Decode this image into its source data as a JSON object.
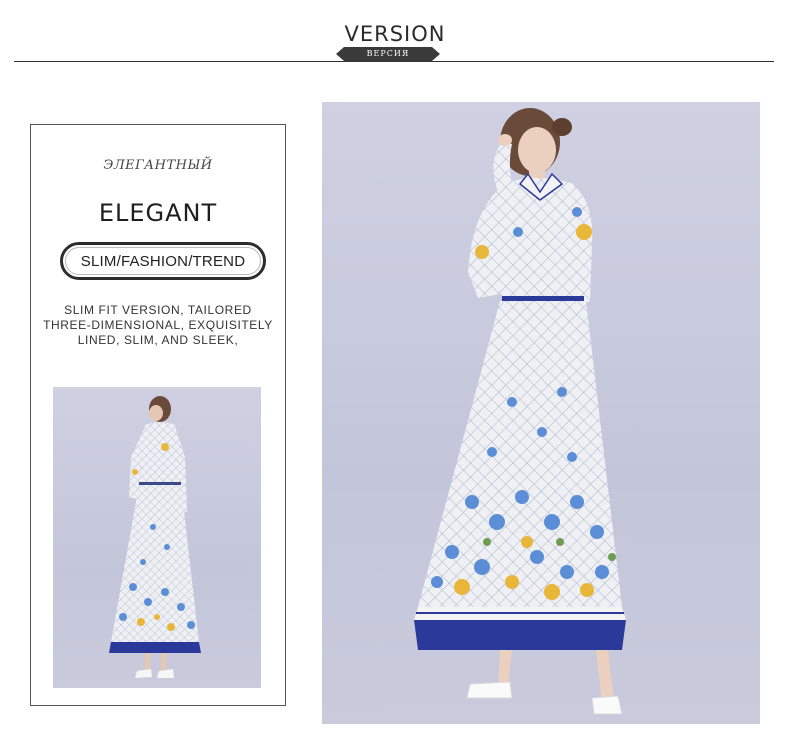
{
  "header": {
    "title": "VERSION",
    "subtitle": "ВЕРСИЯ"
  },
  "card": {
    "russian_title": "ЭЛЕГАНТНЫЙ",
    "english_title": "ELEGANT",
    "pill_text": "SLIM/FASHION/TREND",
    "description": "SLIM FIT VERSION, TAILORED THREE-DIMENSIONAL, EXQUISITELY LINED, SLIM, AND SLEEK,"
  },
  "images": {
    "small_photo": "dress-back-view",
    "large_photo": "dress-front-view"
  },
  "colors": {
    "background": "#ffffff",
    "backdrop": "#c6c8dc",
    "hem_blue": "#2b3a9a",
    "flower_blue": "#5b8ed6",
    "flower_yellow": "#e8b73a",
    "dark": "#2d2d2d"
  }
}
